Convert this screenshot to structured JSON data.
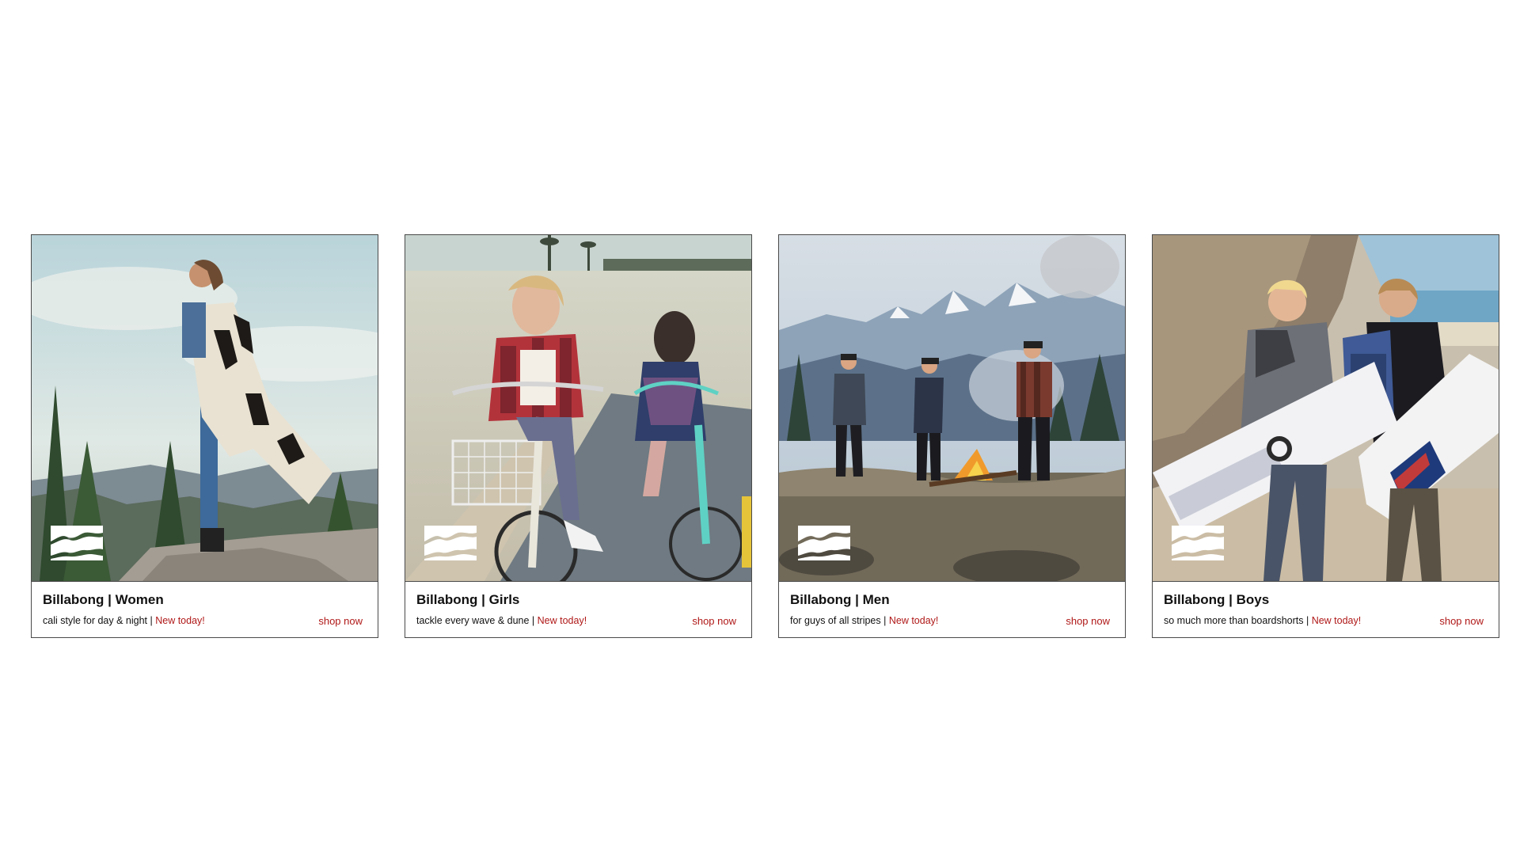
{
  "cards": [
    {
      "title": "Billabong | Women",
      "tagline": "cali style for day & night",
      "separator": " | ",
      "new_label": "New today!",
      "shop_label": "shop now"
    },
    {
      "title": "Billabong | Girls",
      "tagline": "tackle every wave & dune",
      "separator": " | ",
      "new_label": "New today!",
      "shop_label": "shop now"
    },
    {
      "title": "Billabong | Men",
      "tagline": "for guys of all stripes",
      "separator": " | ",
      "new_label": "New today!",
      "shop_label": "shop now"
    },
    {
      "title": "Billabong | Boys",
      "tagline": "so much more than boardshorts",
      "separator": " | ",
      "new_label": "New today!",
      "shop_label": "shop now"
    }
  ],
  "colors": {
    "accent": "#b01818",
    "border": "#4a4a4a",
    "text": "#111111"
  },
  "icons": {
    "logo": "billabong-wave-logo-icon"
  }
}
